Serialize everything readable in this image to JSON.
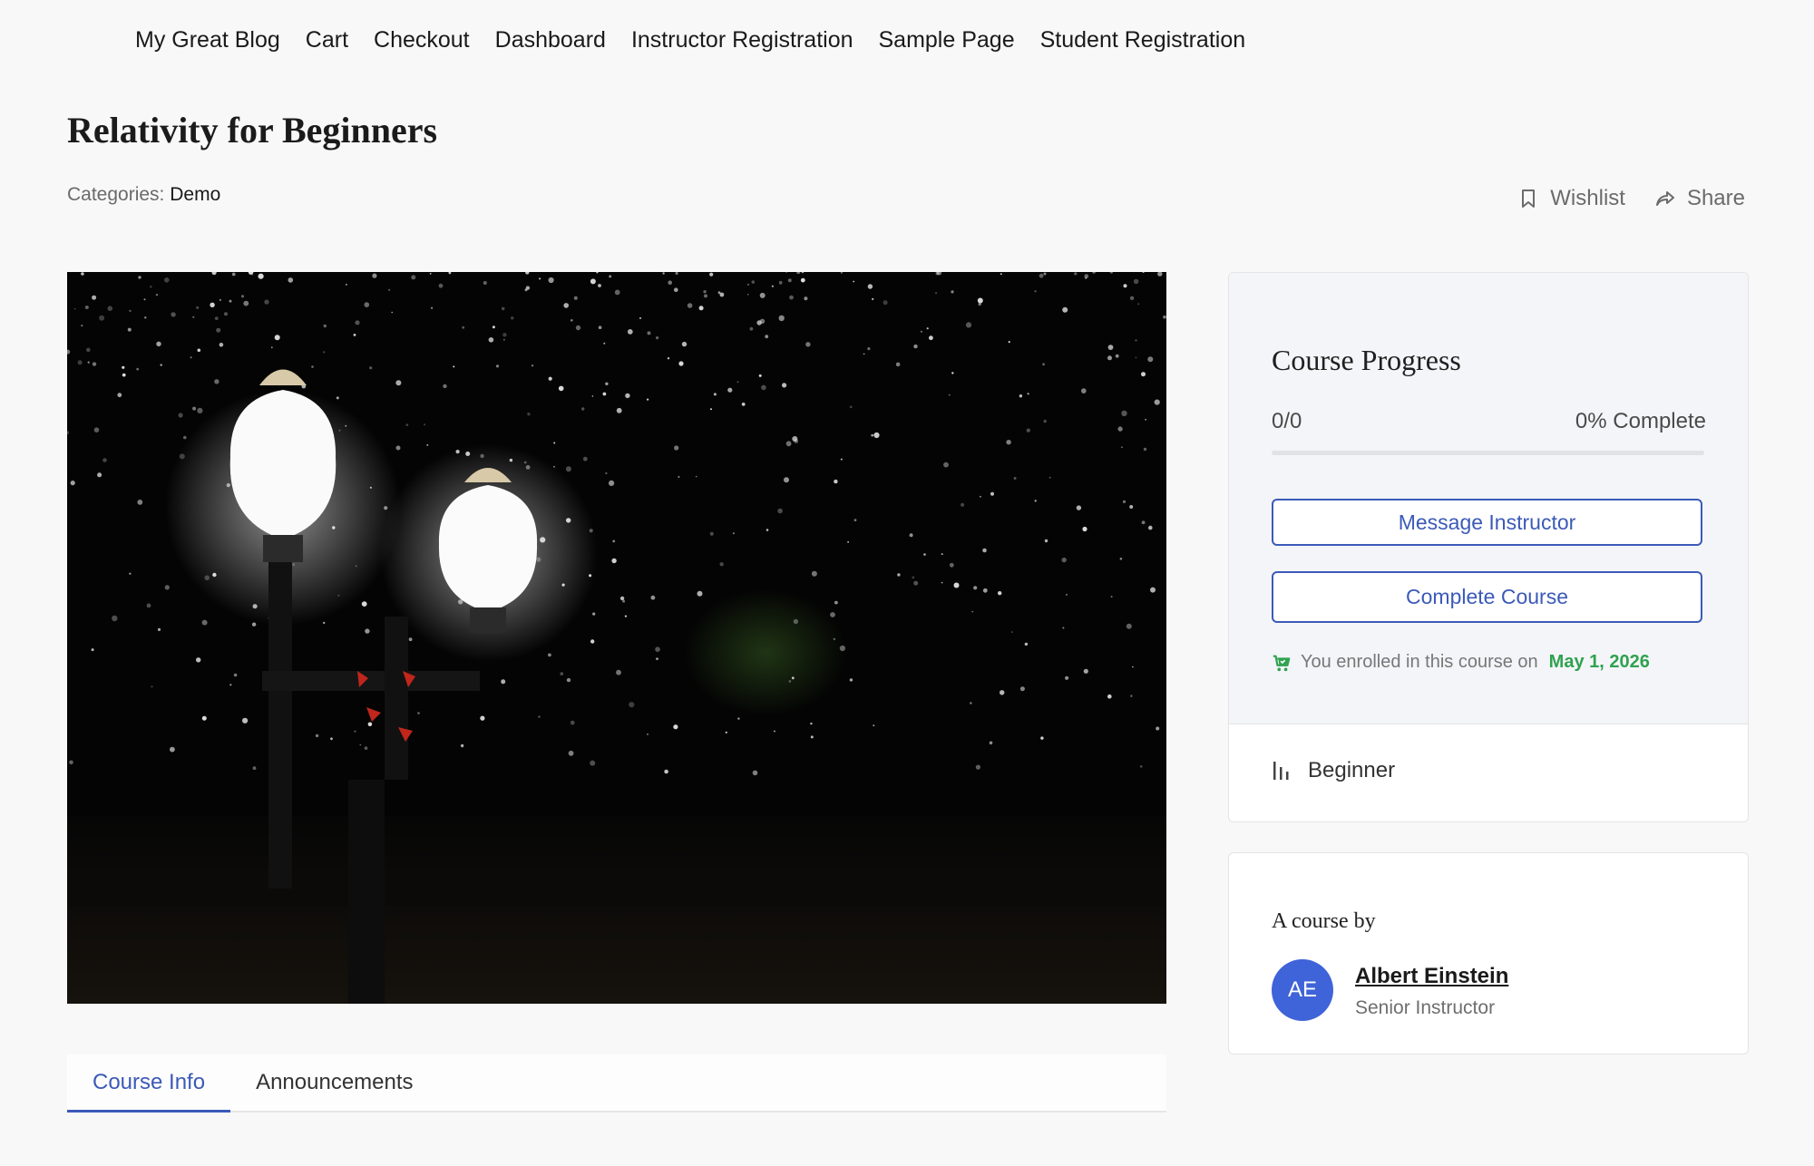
{
  "nav": {
    "items": [
      "My Great Blog",
      "Cart",
      "Checkout",
      "Dashboard",
      "Instructor Registration",
      "Sample Page",
      "Student Registration"
    ]
  },
  "course": {
    "title": "Relativity for Beginners",
    "categories_label": "Categories:",
    "category": "Demo"
  },
  "actions": {
    "wishlist": "Wishlist",
    "share": "Share",
    "wishlist_icon": "bookmark-icon",
    "share_icon": "share-icon"
  },
  "tabs": [
    {
      "label": "Course Info",
      "active": true
    },
    {
      "label": "Announcements",
      "active": false
    }
  ],
  "progress": {
    "title": "Course Progress",
    "count": "0/0",
    "percent_label": "0% Complete",
    "percent": 0,
    "message_button": "Message Instructor",
    "complete_button": "Complete Course",
    "enrolled_text": "You enrolled in this course on",
    "enrolled_date": "May 1, 2026",
    "enrolled_icon": "cart-check-icon",
    "level": "Beginner",
    "level_icon": "level-bars-icon"
  },
  "instructor": {
    "heading": "A course by",
    "initials": "AE",
    "name": "Albert Einstein",
    "role": "Senior Instructor"
  },
  "colors": {
    "accent": "#3b5ab8",
    "avatar": "#3f63d8",
    "success": "#2fa24f",
    "background": "#f8f8f8"
  }
}
